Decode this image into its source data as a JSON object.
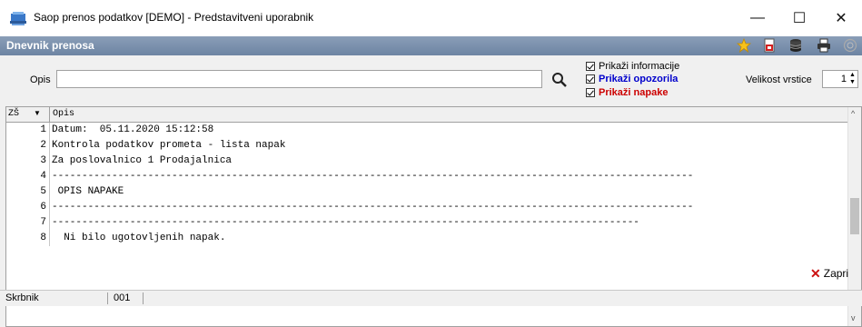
{
  "window": {
    "title": "Saop prenos podatkov [DEMO] - Predstavitveni uporabnik",
    "minimize": "—",
    "maximize": "☐",
    "close": "✕"
  },
  "panel": {
    "title": "Dnevnik prenosa"
  },
  "toolbar_icons": [
    "star-icon",
    "export-pdf-icon",
    "database-icon",
    "print-icon",
    "help-icon"
  ],
  "filter": {
    "opis_label": "Opis",
    "opis_value": "",
    "checkboxes": [
      {
        "label": "Prikaži informacije",
        "checked": true,
        "color": "#000000"
      },
      {
        "label": "Prikaži opozorila",
        "checked": true,
        "color": "#0000cc"
      },
      {
        "label": "Prikaži napake",
        "checked": true,
        "color": "#cc0000"
      }
    ],
    "row_size_label": "Velikost vrstice",
    "row_size_value": "1"
  },
  "grid": {
    "columns": [
      "ZŠ",
      "Opis"
    ],
    "rows": [
      {
        "num": "1",
        "text": "Datum:  05.11.2020 15:12:58"
      },
      {
        "num": "2",
        "text": "Kontrola podatkov prometa - lista napak"
      },
      {
        "num": "3",
        "text": "Za poslovalnico 1 Prodajalnica"
      },
      {
        "num": "4",
        "text": "-----------------------------------------------------------------------------------------------------------"
      },
      {
        "num": "5",
        "text": " OPIS NAPAKE"
      },
      {
        "num": "6",
        "text": "-----------------------------------------------------------------------------------------------------------"
      },
      {
        "num": "7",
        "text": "--------------------------------------------------------------------------------------------------"
      },
      {
        "num": "8",
        "text": "  Ni bilo ugotovljenih napak."
      }
    ]
  },
  "buttons": {
    "close_label": "Zapri"
  },
  "status": {
    "user": "Skrbnik",
    "code": "001"
  }
}
